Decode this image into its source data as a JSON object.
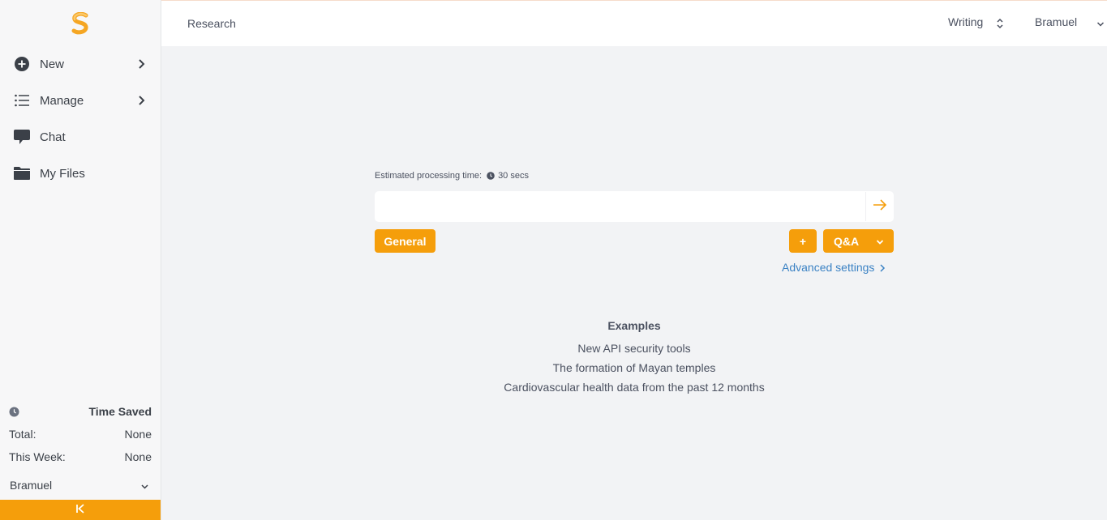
{
  "sidebar": {
    "logo_icon": "s-logo-icon",
    "items": [
      {
        "label": "New",
        "icon": "plus-circle-icon",
        "has_submenu": true
      },
      {
        "label": "Manage",
        "icon": "list-icon",
        "has_submenu": true
      },
      {
        "label": "Chat",
        "icon": "chat-bubble-icon",
        "has_submenu": false
      },
      {
        "label": "My Files",
        "icon": "folder-icon",
        "has_submenu": false
      }
    ],
    "time_saved": {
      "title": "Time Saved",
      "total_label": "Total:",
      "total_value": "None",
      "week_label": "This Week:",
      "week_value": "None"
    },
    "user_name": "Bramuel",
    "collapse_label": "K"
  },
  "topbar": {
    "breadcrumb": "Research",
    "mode": "Writing",
    "user": "Bramuel"
  },
  "main": {
    "estimate_label": "Estimated processing time:",
    "estimate_value": "30 secs",
    "query_value": "",
    "query_placeholder": "",
    "general_button": "General",
    "plus_button": "+",
    "qa_button": "Q&A",
    "advanced_settings": "Advanced settings",
    "examples_title": "Examples",
    "examples": [
      "New API security tools",
      "The formation of Mayan temples",
      "Cardiovascular health data from the past 12 months"
    ]
  },
  "colors": {
    "accent": "#f59e0b",
    "link": "#3b82c4",
    "sidebar_bg": "#f7f7f8",
    "page_bg": "#f2f3f5"
  }
}
